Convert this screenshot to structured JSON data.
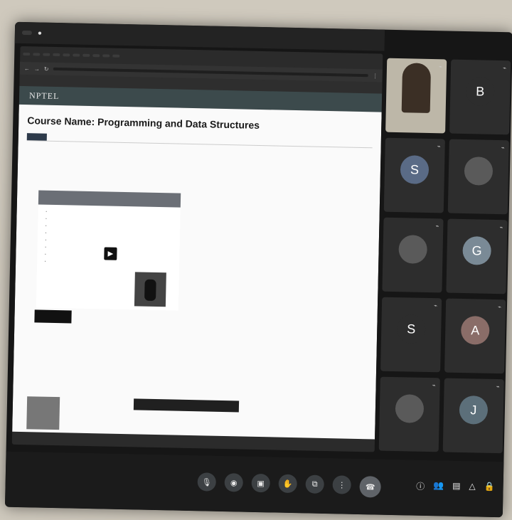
{
  "meeting": {
    "top_pill": "",
    "share_notice": "",
    "name": "",
    "controls": [
      "mic-icon",
      "camera-icon",
      "captions-icon",
      "hand-icon",
      "present-icon",
      "more-icon",
      "end-call-icon"
    ]
  },
  "browser": {
    "tabs": [
      "",
      "",
      "",
      "",
      "",
      "",
      "",
      "",
      "",
      "",
      "",
      "",
      "",
      ""
    ],
    "url": "",
    "bookmarks": [
      "",
      "",
      "",
      "",
      "",
      "",
      "",
      "",
      "",
      ""
    ]
  },
  "site": {
    "logo": "NPTEL",
    "nav": [
      "",
      "",
      "",
      ""
    ]
  },
  "course": {
    "title": "Course Name: Programming and Data Structures",
    "tabs": [
      "",
      "",
      "",
      ""
    ],
    "video_title": "",
    "bullets": [
      "",
      "",
      "",
      "",
      "",
      "",
      "",
      "",
      "",
      ""
    ],
    "video_button": "",
    "side_links": [
      "",
      "",
      "",
      "",
      "",
      ""
    ],
    "section_title": "",
    "section_body": "",
    "instructor_heading": "",
    "instructor_name": "",
    "instructor_desc": "",
    "toast": "",
    "toast_action": ""
  },
  "participants": [
    {
      "name": "",
      "letter": "",
      "color": "#000000",
      "video": true
    },
    {
      "name": "",
      "letter": "B",
      "color": "#2d2d2d",
      "video": false
    },
    {
      "name": "",
      "letter": "S",
      "color": "#5a6b86",
      "video": false
    },
    {
      "name": "",
      "letter": "",
      "color": "#2d2d2d",
      "video": false
    },
    {
      "name": "",
      "letter": "",
      "color": "#2d2d2d",
      "video": false
    },
    {
      "name": "",
      "letter": "G",
      "color": "#7a8a96",
      "video": false
    },
    {
      "name": "",
      "letter": "S",
      "color": "#2d2d2d",
      "video": false
    },
    {
      "name": "",
      "letter": "A",
      "color": "#8a6d68",
      "video": false
    },
    {
      "name": "",
      "letter": "",
      "color": "#2d2d2d",
      "video": false
    },
    {
      "name": "",
      "letter": "J",
      "color": "#5c6f7a",
      "video": false
    }
  ],
  "bottom_right_icons": [
    "info-icon",
    "people-icon",
    "chat-icon",
    "activities-icon",
    "host-controls-icon"
  ]
}
